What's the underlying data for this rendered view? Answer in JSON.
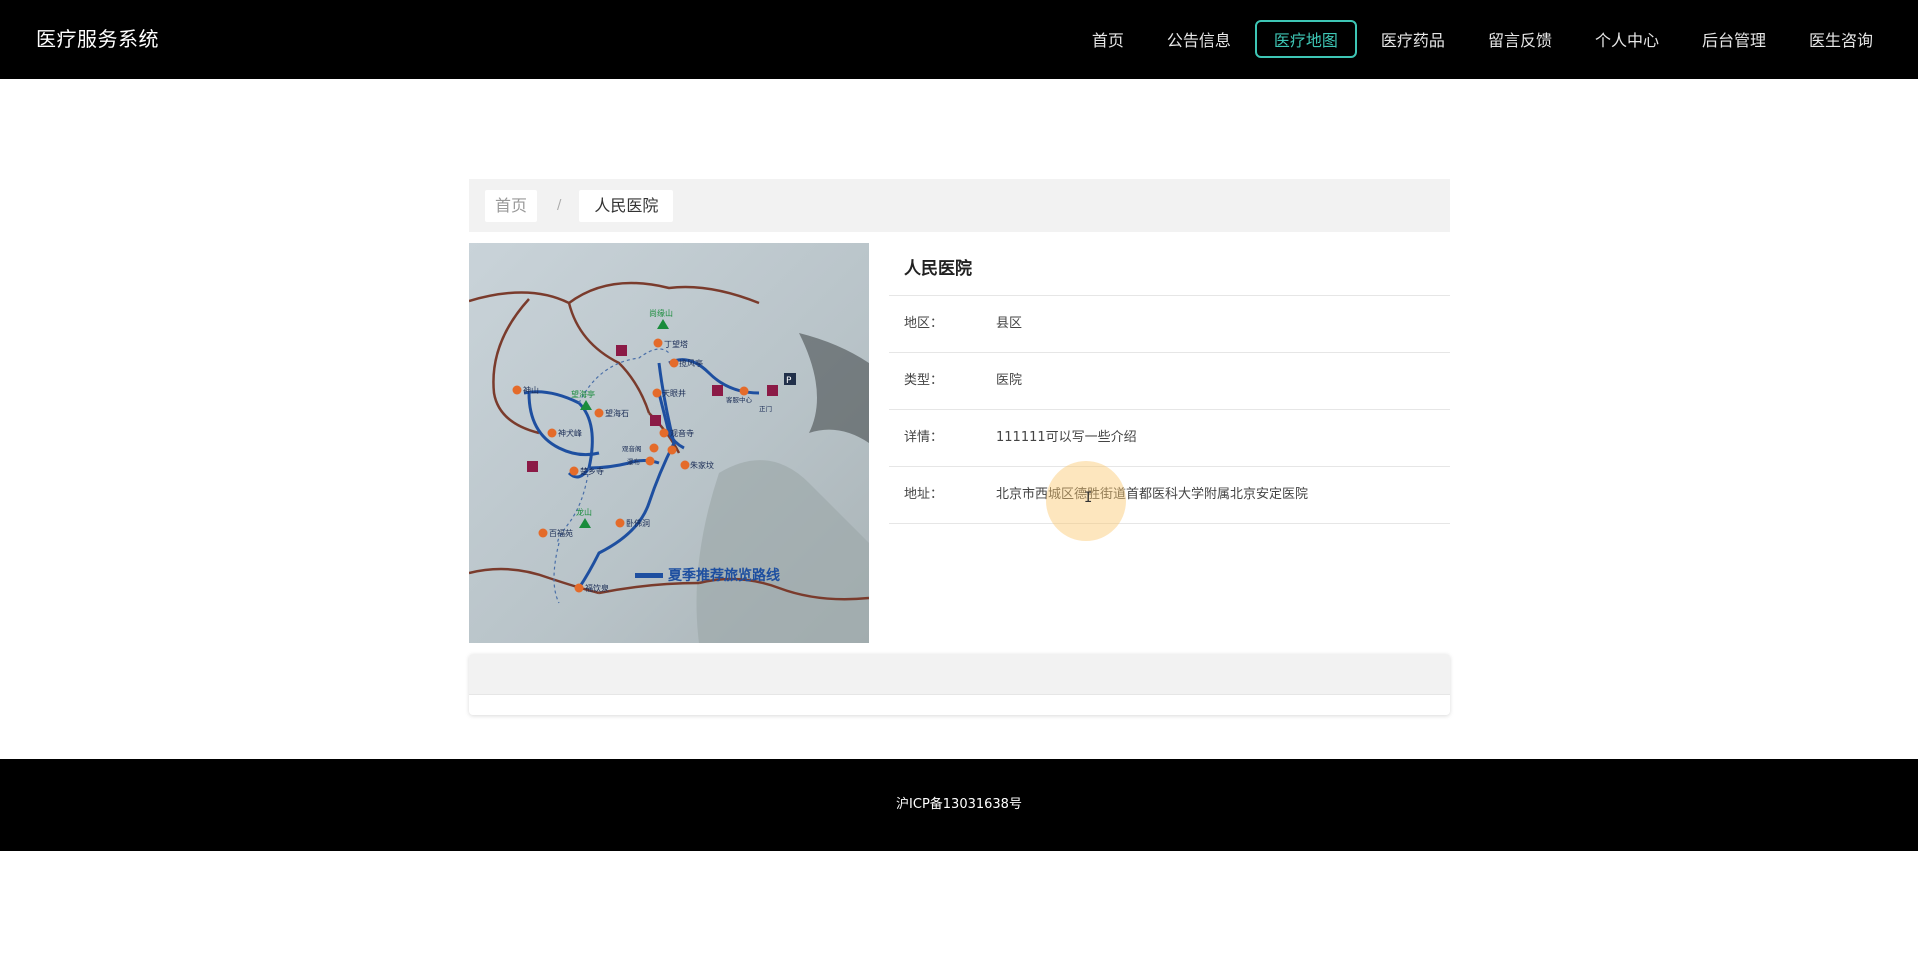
{
  "header": {
    "brand": "医疗服务系统",
    "nav": [
      {
        "label": "首页",
        "active": false
      },
      {
        "label": "公告信息",
        "active": false
      },
      {
        "label": "医疗地图",
        "active": true
      },
      {
        "label": "医疗药品",
        "active": false
      },
      {
        "label": "留言反馈",
        "active": false
      },
      {
        "label": "个人中心",
        "active": false
      },
      {
        "label": "后台管理",
        "active": false
      },
      {
        "label": "医生咨询",
        "active": false
      }
    ],
    "accent_color": "#3ec6b5"
  },
  "breadcrumb": {
    "home": "首页",
    "separator": "/",
    "current": "人民医院"
  },
  "detail": {
    "title": "人民医院",
    "rows": [
      {
        "label": "地区：",
        "value": "县区"
      },
      {
        "label": "类型：",
        "value": "医院"
      },
      {
        "label": "详情：",
        "value": "111111可以写一些介绍"
      },
      {
        "label": "地址：",
        "value": "北京市西城区德胜街道首都医科大学附属北京安定医院"
      }
    ]
  },
  "map_image": {
    "peaks": [
      "尚缘山",
      "望海亭",
      "龙山"
    ],
    "places": [
      "丁望塔",
      "揽风亭",
      "天眼井",
      "客服中心",
      "正门",
      "神山",
      "望海石",
      "神犬峰",
      "观音寺",
      "观音阁",
      "瀑布",
      "朱家坟",
      "楚乡寺",
      "卧佛洞",
      "百福苑",
      "福饮泉"
    ],
    "legend": "夏季推荐旅览路线"
  },
  "footer": {
    "icp": "沪ICP备13031638号"
  }
}
